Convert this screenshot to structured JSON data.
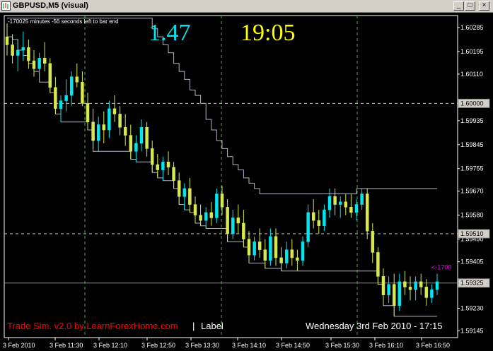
{
  "window": {
    "title": "GBPUSD,M5 (visual)",
    "minimize_label": "_",
    "restore_label": "□",
    "close_label": "×"
  },
  "overlay": {
    "countdown_text": "-170025 minutes -56 seconds left to bar end",
    "big_value": "1.47",
    "big_time": "19:05",
    "arrow_label": "<-1700",
    "footer_brand": "Trade Sim. v2.0 by LearnForexHome.com",
    "footer_sep": "|",
    "footer_label": "Label",
    "footer_date": "Wednesday 3rd Feb 2010 - 17:15"
  },
  "colors": {
    "bull": "#00e5ee",
    "bear": "#d8e850",
    "grid": "#c8c8c8",
    "vgrid": "#3cb44b",
    "line": "#b4b4c8",
    "big_value": "#00e5ee",
    "big_time": "#ffff00",
    "brand": "#ff0000",
    "arrow": "#ff00ff"
  },
  "chart_data": {
    "type": "candlestick",
    "price_axis": [
      "1.60285",
      "1.60195",
      "1.60110",
      "1.60000",
      "1.59935",
      "1.59845",
      "1.59755",
      "1.59670",
      "1.59580",
      "1.59490",
      "1.59405",
      "1.59325",
      "1.59230",
      "1.59145"
    ],
    "time_axis": [
      "3 Feb 2010",
      "3 Feb 11:30",
      "3 Feb 12:10",
      "3 Feb 12:50",
      "3 Feb 13:30",
      "3 Feb 14:10",
      "3 Feb 14:50",
      "3 Feb 15:30",
      "3 Feb 16:10",
      "3 Feb 16:50"
    ],
    "ylim": [
      1.5912,
      1.6033
    ],
    "hlines": {
      "upper": 1.6,
      "middle": 1.5951,
      "current": 1.59325
    },
    "current_price_label": "1.59325",
    "middle_price_label": "1.59510",
    "upper_price_label": "1.60000",
    "candles": [
      [
        1.6025,
        1.603,
        1.6018,
        1.6022
      ],
      [
        1.6022,
        1.6026,
        1.6015,
        1.6018
      ],
      [
        1.6018,
        1.6024,
        1.6012,
        1.602
      ],
      [
        1.602,
        1.6027,
        1.6016,
        1.6021
      ],
      [
        1.6021,
        1.6024,
        1.6013,
        1.6016
      ],
      [
        1.6016,
        1.602,
        1.601,
        1.6013
      ],
      [
        1.6013,
        1.6019,
        1.6008,
        1.6017
      ],
      [
        1.6017,
        1.6023,
        1.6012,
        1.6015
      ],
      [
        1.6015,
        1.6017,
        1.6004,
        1.6006
      ],
      [
        1.6006,
        1.601,
        1.5996,
        1.5998
      ],
      [
        1.5998,
        1.6003,
        1.5993,
        1.6001
      ],
      [
        1.6001,
        1.6009,
        1.5997,
        1.6003
      ],
      [
        1.6003,
        1.6012,
        1.5999,
        1.601
      ],
      [
        1.601,
        1.6015,
        1.6006,
        1.6008
      ],
      [
        1.6008,
        1.6012,
        1.5999,
        1.6
      ],
      [
        1.6,
        1.6004,
        1.599,
        1.5993
      ],
      [
        1.5993,
        1.5998,
        1.5983,
        1.5986
      ],
      [
        1.5986,
        1.5995,
        1.5982,
        1.5992
      ],
      [
        1.5992,
        1.5997,
        1.5985,
        1.599
      ],
      [
        1.599,
        1.6001,
        1.5987,
        1.5998
      ],
      [
        1.5998,
        1.6003,
        1.5993,
        1.5996
      ],
      [
        1.5996,
        1.5999,
        1.5988,
        1.5991
      ],
      [
        1.5991,
        1.5996,
        1.5984,
        1.5988
      ],
      [
        1.5988,
        1.5992,
        1.5979,
        1.5982
      ],
      [
        1.5982,
        1.5988,
        1.5978,
        1.5985
      ],
      [
        1.5985,
        1.5994,
        1.5982,
        1.5991
      ],
      [
        1.5991,
        1.5993,
        1.598,
        1.5983
      ],
      [
        1.5983,
        1.5986,
        1.5974,
        1.5977
      ],
      [
        1.5977,
        1.5981,
        1.5972,
        1.5975
      ],
      [
        1.5975,
        1.598,
        1.5971,
        1.5978
      ],
      [
        1.5978,
        1.5982,
        1.5973,
        1.5976
      ],
      [
        1.5976,
        1.5978,
        1.5968,
        1.5971
      ],
      [
        1.5971,
        1.5974,
        1.5962,
        1.5965
      ],
      [
        1.5965,
        1.597,
        1.596,
        1.5968
      ],
      [
        1.5968,
        1.5972,
        1.5959,
        1.5962
      ],
      [
        1.5962,
        1.5965,
        1.5955,
        1.5958
      ],
      [
        1.5958,
        1.5962,
        1.5954,
        1.5956
      ],
      [
        1.5956,
        1.5961,
        1.5953,
        1.5959
      ],
      [
        1.5959,
        1.5963,
        1.5954,
        1.5957
      ],
      [
        1.5957,
        1.5968,
        1.5955,
        1.5966
      ],
      [
        1.5966,
        1.5969,
        1.5958,
        1.5961
      ],
      [
        1.5961,
        1.5964,
        1.5948,
        1.5951
      ],
      [
        1.5951,
        1.596,
        1.5949,
        1.5957
      ],
      [
        1.5957,
        1.5962,
        1.5951,
        1.5955
      ],
      [
        1.5955,
        1.596,
        1.5946,
        1.5949
      ],
      [
        1.5949,
        1.5952,
        1.594,
        1.5943
      ],
      [
        1.5943,
        1.595,
        1.5941,
        1.5948
      ],
      [
        1.5948,
        1.5953,
        1.5942,
        1.5945
      ],
      [
        1.5945,
        1.5949,
        1.5938,
        1.5941
      ],
      [
        1.5941,
        1.5953,
        1.5939,
        1.595
      ],
      [
        1.595,
        1.5953,
        1.5939,
        1.5942
      ],
      [
        1.5942,
        1.5946,
        1.5937,
        1.594
      ],
      [
        1.594,
        1.5948,
        1.5938,
        1.5945
      ],
      [
        1.5945,
        1.5949,
        1.5939,
        1.5942
      ],
      [
        1.5942,
        1.5945,
        1.5937,
        1.5941
      ],
      [
        1.5941,
        1.595,
        1.5939,
        1.5948
      ],
      [
        1.5948,
        1.5962,
        1.5946,
        1.5959
      ],
      [
        1.5959,
        1.5964,
        1.5953,
        1.5956
      ],
      [
        1.5956,
        1.596,
        1.5951,
        1.5954
      ],
      [
        1.5954,
        1.5962,
        1.5952,
        1.596
      ],
      [
        1.596,
        1.5968,
        1.5957,
        1.5965
      ],
      [
        1.5965,
        1.5968,
        1.5958,
        1.5962
      ],
      [
        1.5962,
        1.5965,
        1.5957,
        1.5963
      ],
      [
        1.5963,
        1.5966,
        1.5958,
        1.5961
      ],
      [
        1.5961,
        1.5966,
        1.5957,
        1.5959
      ],
      [
        1.5959,
        1.5964,
        1.5956,
        1.5962
      ],
      [
        1.5962,
        1.5968,
        1.596,
        1.5966
      ],
      [
        1.5966,
        1.5968,
        1.5949,
        1.5952
      ],
      [
        1.5952,
        1.5955,
        1.594,
        1.5944
      ],
      [
        1.5944,
        1.5946,
        1.5932,
        1.5935
      ],
      [
        1.5935,
        1.5938,
        1.5924,
        1.5928
      ],
      [
        1.5928,
        1.5935,
        1.5925,
        1.5932
      ],
      [
        1.5932,
        1.5936,
        1.592,
        1.5924
      ],
      [
        1.5924,
        1.5936,
        1.5922,
        1.5933
      ],
      [
        1.5933,
        1.5937,
        1.5928,
        1.5931
      ],
      [
        1.5931,
        1.5935,
        1.5926,
        1.593
      ],
      [
        1.593,
        1.5935,
        1.5926,
        1.5933
      ],
      [
        1.5933,
        1.5936,
        1.5928,
        1.5931
      ],
      [
        1.5931,
        1.5934,
        1.5924,
        1.5927
      ],
      [
        1.5927,
        1.5932,
        1.5925,
        1.593
      ],
      [
        1.593,
        1.5936,
        1.5928,
        1.5933
      ]
    ],
    "lower_band": [
      1.6025,
      1.6024,
      1.602,
      1.6018,
      1.6015,
      1.6012,
      1.6008,
      1.6008,
      1.6004,
      1.5996,
      1.5993,
      1.5993,
      1.5993,
      1.5993,
      1.5993,
      1.599,
      1.5982,
      1.5982,
      1.5982,
      1.5982,
      1.5982,
      1.5982,
      1.5982,
      1.5979,
      1.5978,
      1.5978,
      1.5978,
      1.5974,
      1.5972,
      1.5971,
      1.5971,
      1.5968,
      1.5962,
      1.596,
      1.5959,
      1.5955,
      1.5954,
      1.5953,
      1.5953,
      1.5953,
      1.5953,
      1.5948,
      1.5948,
      1.5948,
      1.5946,
      1.594,
      1.594,
      1.594,
      1.5938,
      1.5938,
      1.5938,
      1.5937,
      1.5937,
      1.5937,
      1.5937,
      1.5937,
      1.5937,
      1.5937,
      1.5937,
      1.5937,
      1.5937,
      1.5937,
      1.5937,
      1.5937,
      1.5937,
      1.5937,
      1.5937,
      1.5937,
      1.5937,
      1.5932,
      1.5924,
      1.5924,
      1.592,
      1.592,
      1.592,
      1.592,
      1.592,
      1.592,
      1.592,
      1.592,
      1.592
    ],
    "upper_band": [
      1.6032,
      1.6032,
      1.6032,
      1.6032,
      1.6032,
      1.6032,
      1.6032,
      1.6032,
      1.6032,
      1.6032,
      1.6032,
      1.6032,
      1.6032,
      1.6032,
      1.6032,
      1.6032,
      1.6032,
      1.6032,
      1.6032,
      1.6032,
      1.6032,
      1.6032,
      1.6032,
      1.6032,
      1.6032,
      1.6032,
      1.6032,
      1.6028,
      1.6025,
      1.6022,
      1.6019,
      1.6015,
      1.6012,
      1.6009,
      1.6005,
      1.6003,
      1.6,
      1.5994,
      1.599,
      1.5986,
      1.5983,
      1.598,
      1.5977,
      1.5975,
      1.5972,
      1.597,
      1.5968,
      1.5966,
      1.5966,
      1.5966,
      1.5966,
      1.5966,
      1.5966,
      1.5966,
      1.5966,
      1.5966,
      1.5966,
      1.5966,
      1.5966,
      1.5966,
      1.5966,
      1.5966,
      1.5966,
      1.5966,
      1.5966,
      1.5968,
      1.5968,
      1.5968,
      1.5968,
      1.5968,
      1.5968,
      1.5968,
      1.5968,
      1.5968,
      1.5968,
      1.5968,
      1.5968,
      1.5968,
      1.5968,
      1.5968,
      1.5968
    ]
  }
}
